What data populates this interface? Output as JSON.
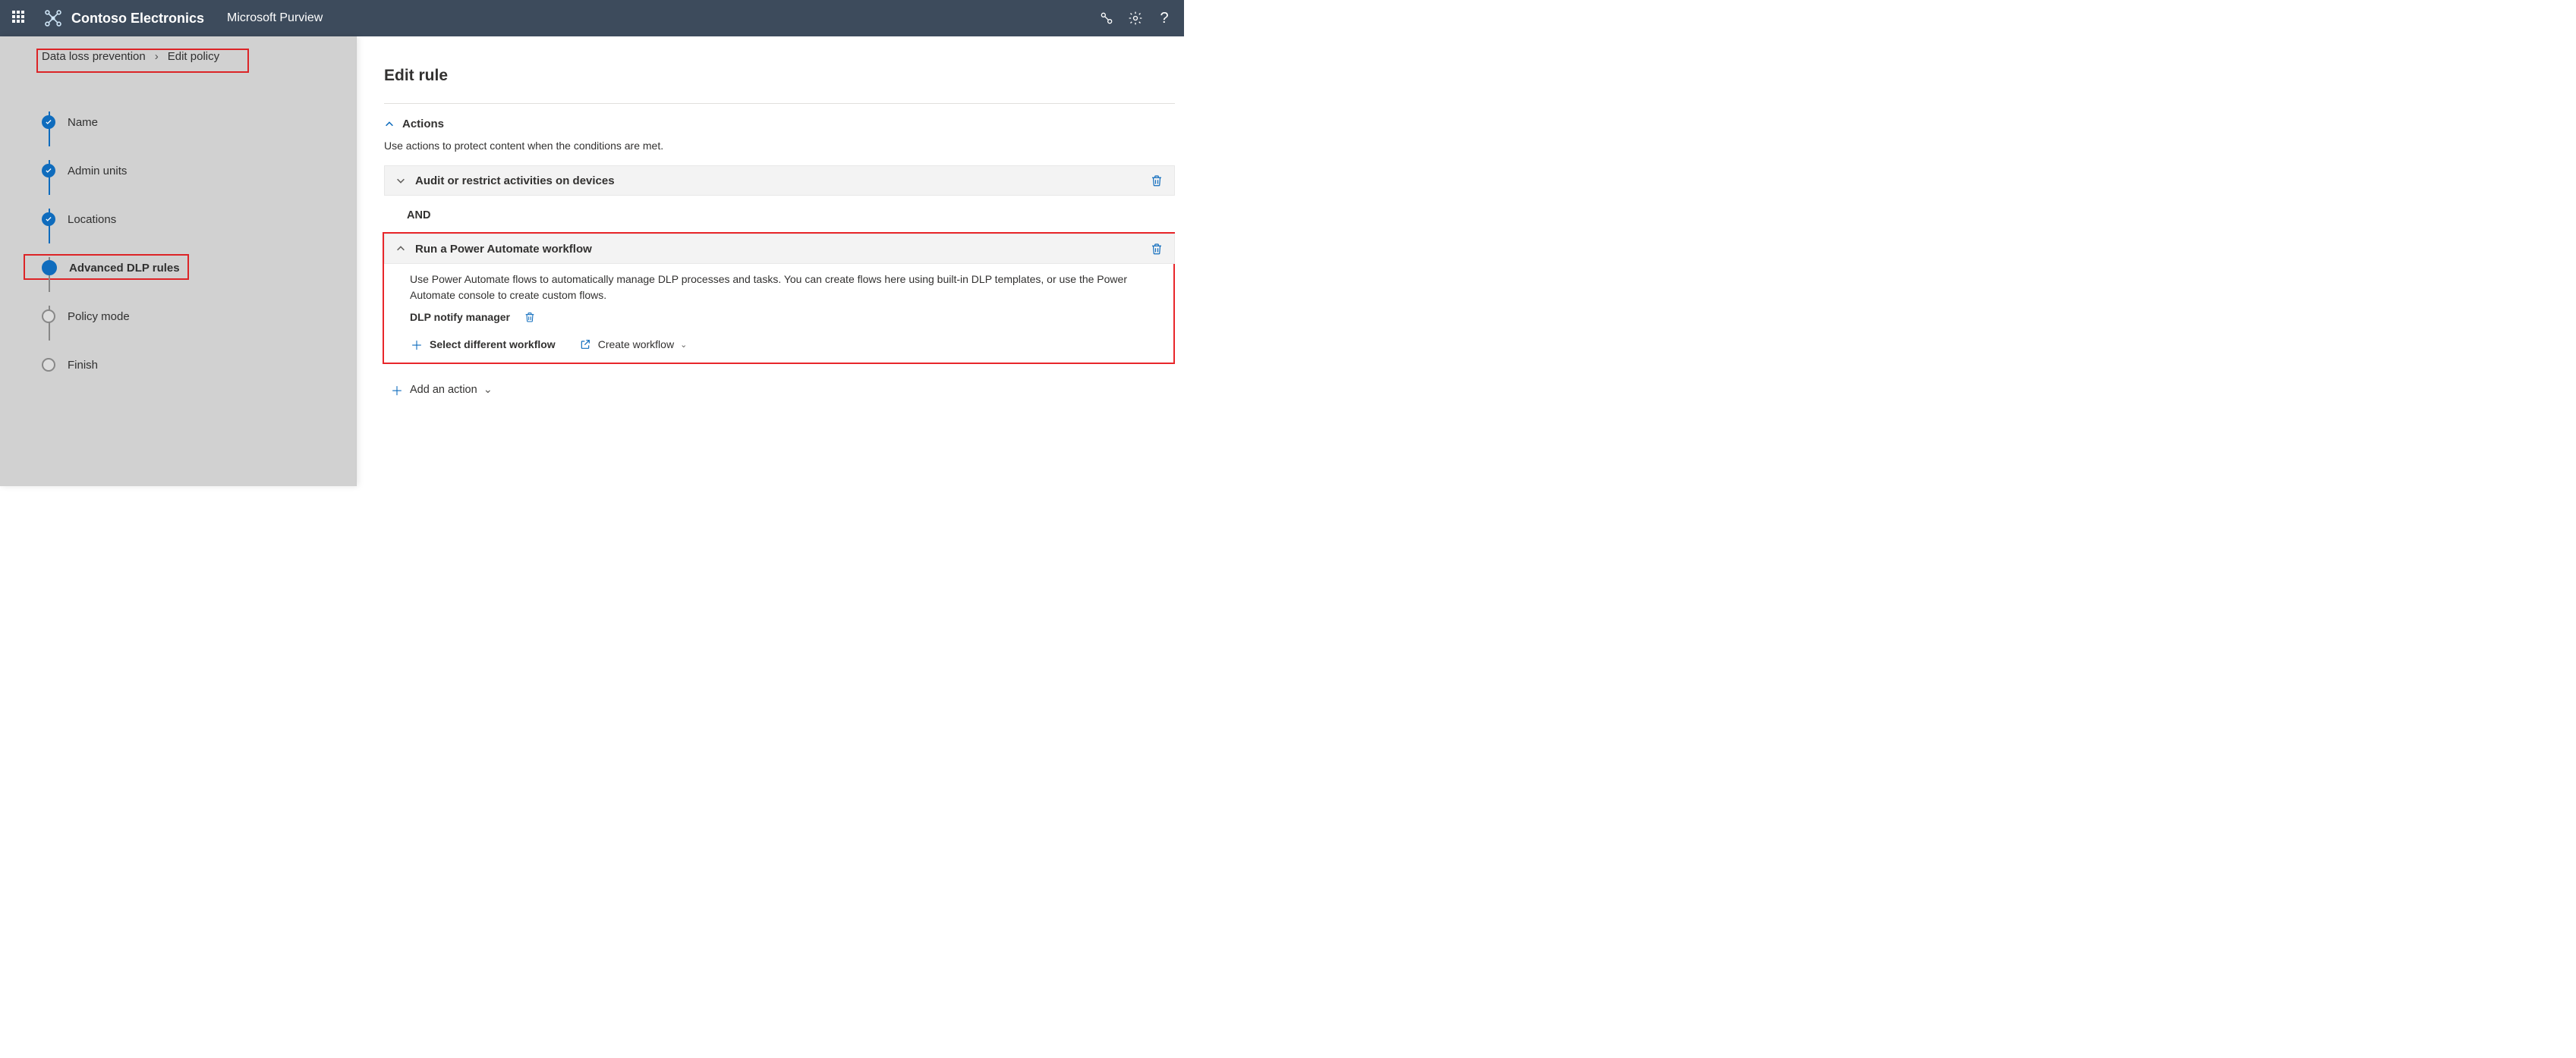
{
  "header": {
    "brand": "Contoso Electronics",
    "product": "Microsoft Purview"
  },
  "breadcrumb": {
    "parent": "Data loss prevention",
    "current": "Edit policy"
  },
  "steps": [
    {
      "label": "Name",
      "state": "done"
    },
    {
      "label": "Admin units",
      "state": "done"
    },
    {
      "label": "Locations",
      "state": "done"
    },
    {
      "label": "Advanced DLP rules",
      "state": "current"
    },
    {
      "label": "Policy mode",
      "state": "pending"
    },
    {
      "label": "Finish",
      "state": "pending"
    }
  ],
  "main": {
    "title": "Edit rule",
    "actions_section": "Actions",
    "actions_desc": "Use actions to protect content when the conditions are met.",
    "audit_title": "Audit or restrict activities on devices",
    "and": "AND",
    "pa_title": "Run a Power Automate workflow",
    "pa_desc": "Use Power Automate flows to automatically manage DLP processes and tasks. You can create flows here using built-in DLP templates, or use the Power Automate console to create custom flows.",
    "workflow_name": "DLP notify manager",
    "select_workflow": "Select different workflow",
    "create_workflow": "Create workflow",
    "add_action": "Add an action"
  }
}
